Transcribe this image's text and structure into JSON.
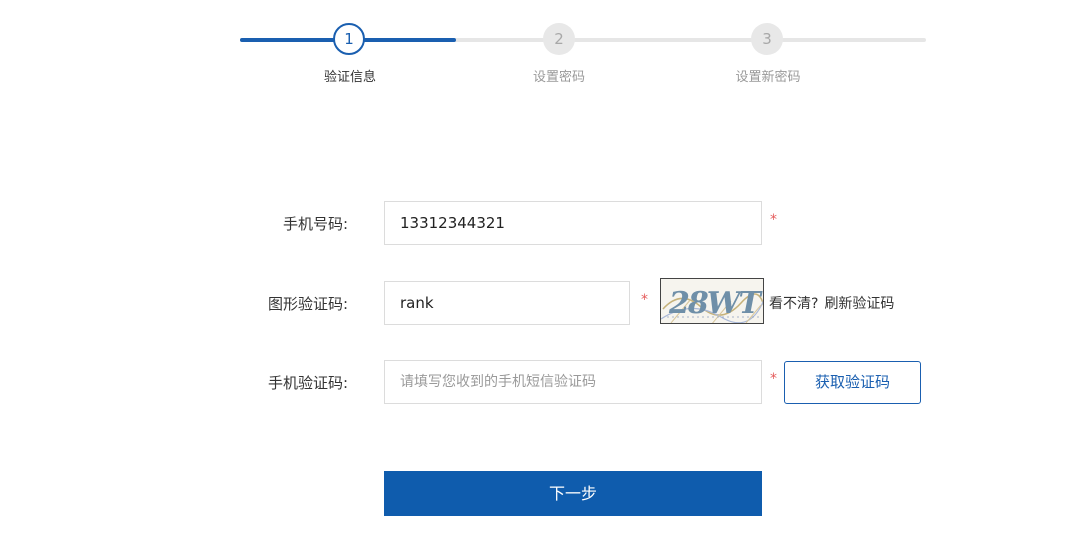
{
  "stepper": {
    "steps": [
      {
        "number": "1",
        "label": "验证信息",
        "state": "active"
      },
      {
        "number": "2",
        "label": "设置密码",
        "state": "pending"
      },
      {
        "number": "3",
        "label": "设置新密码",
        "state": "pending"
      }
    ]
  },
  "form": {
    "phone": {
      "label": "手机号码:",
      "value": "13312344321",
      "required_mark": "*"
    },
    "captcha": {
      "label": "图形验证码:",
      "value": "rank",
      "required_mark": "*",
      "image_text": "28WT",
      "refresh_prefix": "看不清?",
      "refresh_link": "刷新验证码"
    },
    "sms_code": {
      "label": "手机验证码:",
      "value": "",
      "placeholder": "请填写您收到的手机短信验证码",
      "required_mark": "*",
      "button_label": "获取验证码"
    },
    "next_label": "下一步"
  },
  "colors": {
    "accent": "#1a5fb0",
    "required": "#e55b5b",
    "primary_button": "#0f5cad"
  }
}
